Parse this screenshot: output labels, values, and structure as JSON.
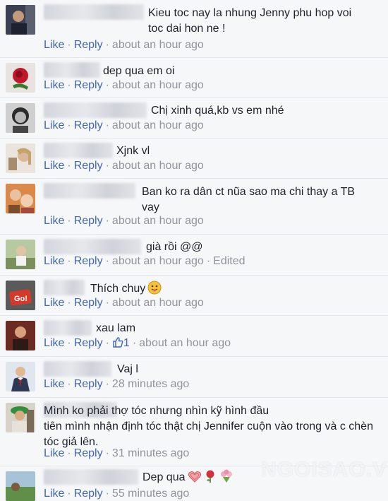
{
  "colors": {
    "link": "#4267b2",
    "meta": "#90949c",
    "text": "#1d2129"
  },
  "actions": {
    "like": "Like",
    "reply": "Reply"
  },
  "comments": [
    {
      "text": "Kieu toc nay la nhung Jenny phu hop voi\ntoc dai hon ne !",
      "time": "about an hour ago",
      "avatar": "avatar-man-photo"
    },
    {
      "text": "dep qua em oi",
      "time": "about an hour ago",
      "avatar": "avatar-rose-photo"
    },
    {
      "text": "Chị xinh quá,kb vs em nhé",
      "time": "about an hour ago",
      "avatar": "avatar-girl-bw-photo"
    },
    {
      "text": "Xjnk vl",
      "time": "about an hour ago",
      "avatar": "avatar-woman-photo"
    },
    {
      "text": "Ban ko ra dân ct nũa sao ma chi thay a TB\nvay",
      "time": "about an hour ago",
      "avatar": "avatar-family-photo"
    },
    {
      "text": "già rồi @@",
      "time": "about an hour ago",
      "edited": "Edited",
      "avatar": "avatar-outdoor-photo"
    },
    {
      "text": "Thích chuy",
      "time": "about an hour ago",
      "avatar": "avatar-go-sign-photo"
    },
    {
      "text": "xau lam",
      "time": "about an hour ago",
      "likes": "1",
      "avatar": "avatar-red-photo"
    },
    {
      "text": "Vaj l",
      "time": "28 minutes ago",
      "avatar": "avatar-suit-man-photo"
    },
    {
      "text": "Mình ko phải thợ tóc nhưng nhìn kỹ hình đầu\ntiên mình nhận định tóc thật chị Jennifer cuộn vào trong và c chèn\ntóc giả lên.",
      "time": "31 minutes ago",
      "avatar": "avatar-woman-green-hat-photo"
    },
    {
      "text": "Dep qua",
      "time": "55 minutes ago",
      "avatar": "avatar-landscape-photo"
    }
  ],
  "watermark": "NGOISAO.VN"
}
